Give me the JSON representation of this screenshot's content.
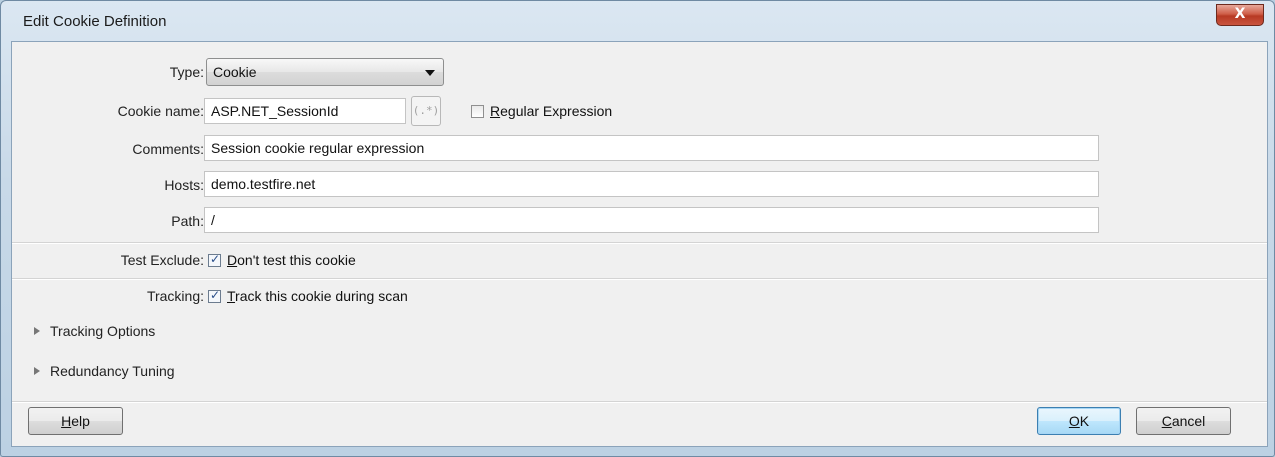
{
  "window": {
    "title": "Edit Cookie Definition",
    "close_label": "X"
  },
  "form": {
    "type": {
      "label": "Type:",
      "value": "Cookie"
    },
    "cookie_name": {
      "label": "Cookie name:",
      "value": "ASP.NET_SessionId",
      "regex_button": "(.*)",
      "regex_checkbox": {
        "label_first": "R",
        "label_rest": "egular Expression",
        "checked": false
      }
    },
    "comments": {
      "label": "Comments:",
      "value": "Session cookie regular expression"
    },
    "hosts": {
      "label": "Hosts:",
      "value": "demo.testfire.net"
    },
    "path": {
      "label": "Path:",
      "value": "/"
    },
    "test_exclude": {
      "label": "Test Exclude:",
      "checkbox_first": "D",
      "checkbox_rest": "on't test this cookie",
      "checked": true
    },
    "tracking": {
      "label": "Tracking:",
      "checkbox_first": "T",
      "checkbox_rest": "rack this cookie during scan",
      "checked": true
    }
  },
  "sections": [
    {
      "label": "Tracking Options",
      "expanded": false
    },
    {
      "label": "Redundancy Tuning",
      "expanded": false
    }
  ],
  "buttons": {
    "help": {
      "first": "H",
      "rest": "elp"
    },
    "ok": {
      "first": "O",
      "rest": "K"
    },
    "cancel": {
      "first": "C",
      "rest": "ancel"
    }
  },
  "colors": {
    "title_bar": "#c8d9e8",
    "client_bg": "#f0f0f0",
    "close_red": "#c9553f",
    "default_button": "#bee6fd"
  },
  "icons": {
    "expander": "triangle-right-icon",
    "close": "close-icon"
  }
}
